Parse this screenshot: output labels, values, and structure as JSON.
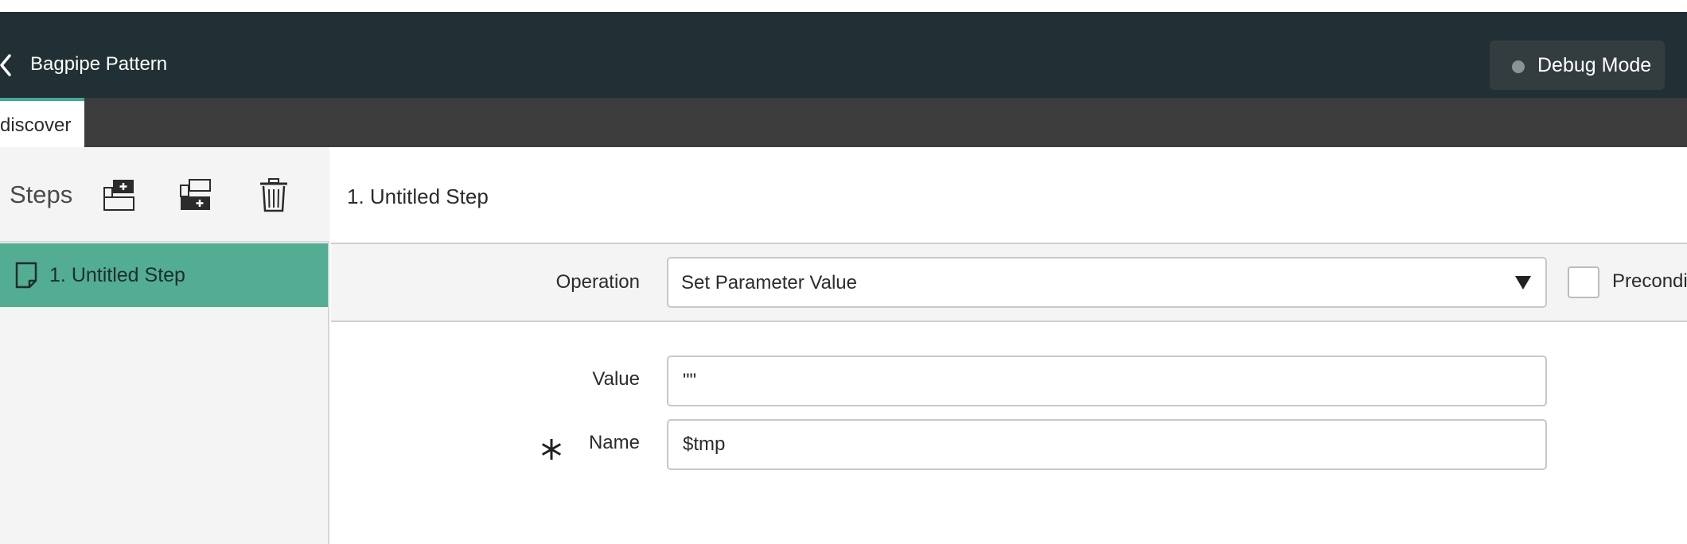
{
  "header": {
    "title": "Bagpipe Pattern",
    "debug_label": "Debug Mode"
  },
  "tabs": [
    {
      "label": "discover",
      "active": true
    }
  ],
  "sidebar": {
    "steps_label": "Steps",
    "tools": [
      {
        "name": "add-step-before-icon"
      },
      {
        "name": "add-step-after-icon"
      },
      {
        "name": "trash-icon"
      }
    ],
    "items": [
      {
        "number": "1.",
        "label": "Untitled Step",
        "selected": true
      }
    ]
  },
  "main": {
    "step_title": "1. Untitled Step",
    "operation": {
      "label": "Operation",
      "value": "Set Parameter Value"
    },
    "precondition_label": "Precondi",
    "fields": [
      {
        "label": "Value",
        "value": "\"\"",
        "required": false
      },
      {
        "label": "Name",
        "value": "$tmp",
        "required": true
      }
    ]
  },
  "colors": {
    "header_bg": "#213035",
    "tabbar_bg": "#3c3c3c",
    "accent": "#46a891",
    "selected_step_bg": "#52ad93"
  }
}
